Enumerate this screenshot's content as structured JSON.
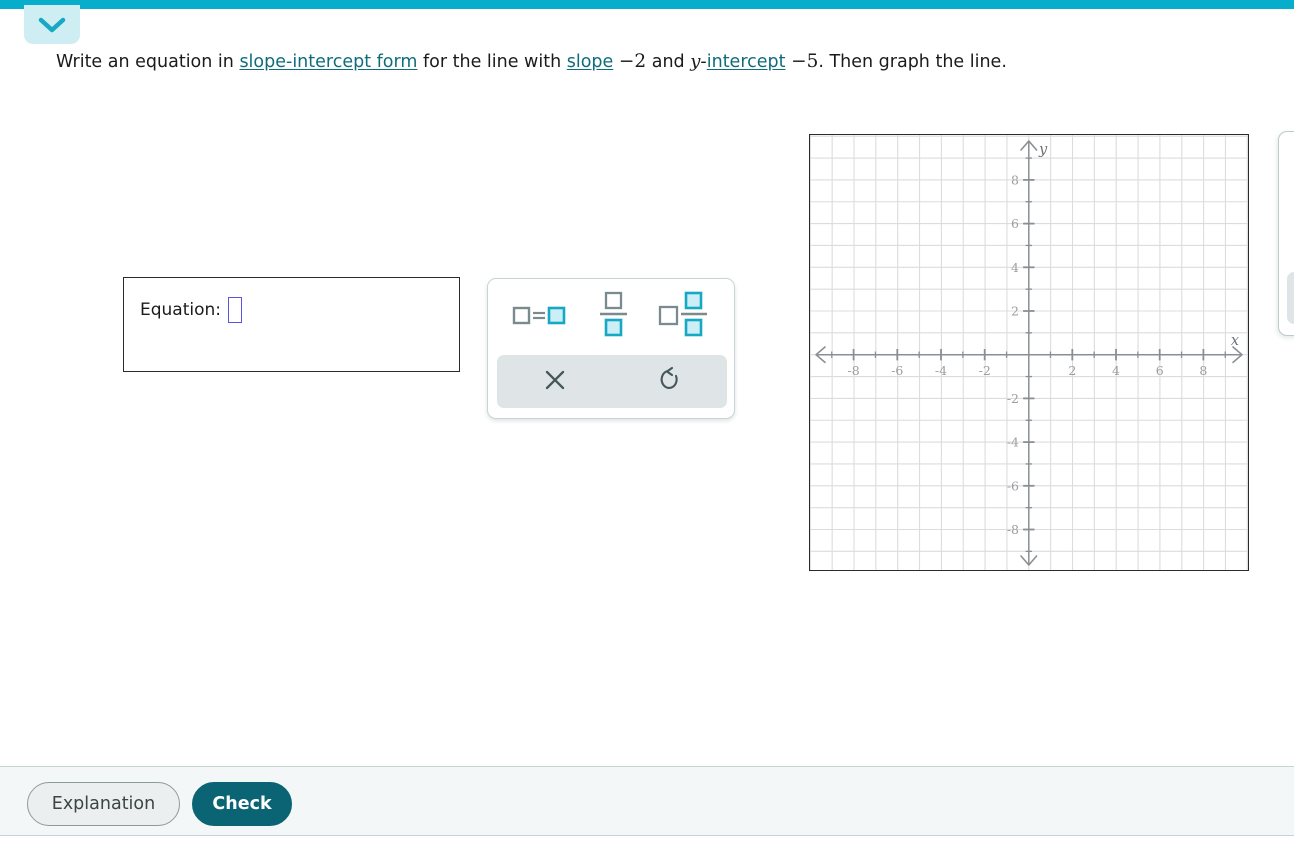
{
  "colors": {
    "top_bar": "#06aecc",
    "tab_bg": "#cfeef3",
    "link": "#0f6d7a",
    "check_button": "#0b6473",
    "keypad_accent": "#17a8c4",
    "slot_border": "#5b52e0",
    "grid": "#d9d9d9",
    "axis": "#8a8f94"
  },
  "header": {
    "collapse_icon": "chevron-down-icon"
  },
  "prompt": {
    "part1": "Write an equation in ",
    "link1": "slope-intercept form",
    "part2": " for the line with ",
    "link2": "slope",
    "slope_value": "−2",
    "part3": " and ",
    "y_var": "y",
    "dash": "-",
    "link3": "intercept",
    "intercept_value": "−5",
    "part4": ". Then graph the line."
  },
  "answer": {
    "label": "Equation:",
    "value": "",
    "placeholder": ""
  },
  "keypad": {
    "buttons": [
      {
        "name": "equation-template-button",
        "icon": "box-equals-box-icon",
        "label": "□=□"
      },
      {
        "name": "fraction-template-button",
        "icon": "fraction-icon",
        "label": "□/□"
      },
      {
        "name": "mixed-number-template-button",
        "icon": "mixed-number-icon",
        "label": "□ □/□"
      }
    ],
    "actions": [
      {
        "name": "clear-button",
        "icon": "close-x-icon",
        "label": "×"
      },
      {
        "name": "undo-button",
        "icon": "undo-arrow-icon",
        "label": "↺"
      }
    ]
  },
  "graph": {
    "x_axis_label": "x",
    "y_axis_label": "y",
    "x_ticks": [
      "-8",
      "-6",
      "-4",
      "-2",
      "2",
      "4",
      "6",
      "8"
    ],
    "y_ticks": [
      "8",
      "6",
      "4",
      "2",
      "-2",
      "-4",
      "-6",
      "-8"
    ],
    "x_range": [
      -10,
      10
    ],
    "y_range": [
      -10,
      10
    ],
    "grid_step": 1,
    "label_step": 2,
    "plotted_points": [],
    "plotted_lines": []
  },
  "footer": {
    "explanation_label": "Explanation",
    "check_label": "Check"
  },
  "chart_data": {
    "type": "scatter",
    "title": "",
    "xlabel": "x",
    "ylabel": "y",
    "xlim": [
      -10,
      10
    ],
    "ylim": [
      -10,
      10
    ],
    "xticks": [
      -8,
      -6,
      -4,
      -2,
      2,
      4,
      6,
      8
    ],
    "yticks": [
      8,
      6,
      4,
      2,
      -2,
      -4,
      -6,
      -8
    ],
    "grid": true,
    "legend": "none",
    "series": [
      {
        "name": "user-line",
        "x": [],
        "y": []
      }
    ],
    "annotations": []
  }
}
